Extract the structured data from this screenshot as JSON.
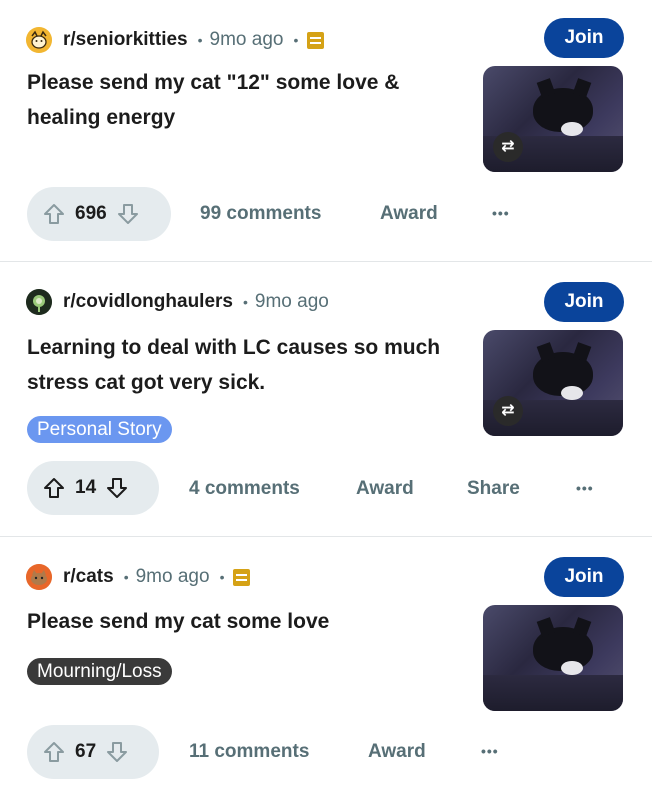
{
  "posts": [
    {
      "subreddit": "r/seniorkitties",
      "time": "9mo ago",
      "join_label": "Join",
      "title": "Please send my cat \"12\" some love & healing energy",
      "flair": "",
      "votes": "696",
      "comments": "99 comments",
      "award": "Award",
      "share": ""
    },
    {
      "subreddit": "r/covidlonghaulers",
      "time": "9mo ago",
      "join_label": "Join",
      "title": "Learning to deal with LC causes so much stress cat got very sick.",
      "flair": "Personal Story",
      "votes": "14",
      "comments": "4 comments",
      "award": "Award",
      "share": "Share"
    },
    {
      "subreddit": "r/cats",
      "time": "9mo ago",
      "join_label": "Join",
      "title": "Please send my cat some love",
      "flair": "Mourning/Loss",
      "votes": "67",
      "comments": "11 comments",
      "award": "Award",
      "share": ""
    }
  ],
  "icons": {
    "upvote": "arrow-up-icon",
    "downvote": "arrow-down-icon",
    "crosspost": "crosspost-icon",
    "more": "more-options-icon",
    "mod": "moderator-icon"
  },
  "colors": {
    "join_bg": "#0a449b",
    "flair_blue": "#6b97f0",
    "flair_dark": "#3a3a3a",
    "vote_pill": "#e5ebee",
    "mod_badge": "#d5a216"
  }
}
